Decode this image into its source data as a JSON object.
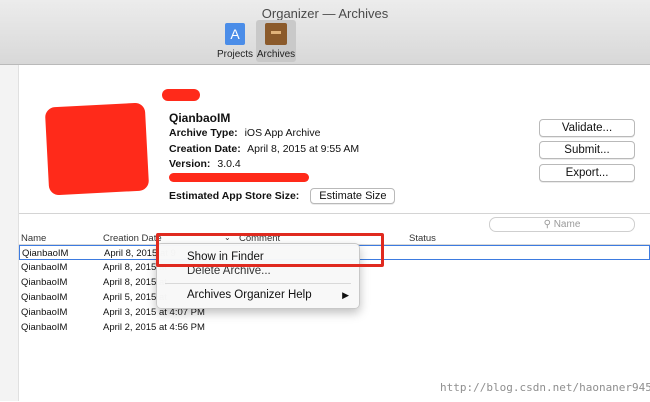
{
  "window": {
    "title": "Organizer — Archives"
  },
  "toolbar": {
    "tabs": [
      {
        "label": "Projects",
        "icon": "projects-icon"
      },
      {
        "label": "Archives",
        "icon": "archives-icon",
        "selected": true
      }
    ]
  },
  "archive": {
    "name": "QianbaoIM",
    "type_label": "Archive Type:",
    "type_value": "iOS App Archive",
    "date_label": "Creation Date:",
    "date_value": "April 8, 2015 at 9:55 AM",
    "version_label": "Version:",
    "version_value": "3.0.4",
    "size_label": "Estimated App Store Size:",
    "size_button": "Estimate Size"
  },
  "actions": {
    "validate": "Validate...",
    "submit": "Submit...",
    "export": "Export..."
  },
  "search": {
    "placeholder": "Name"
  },
  "table": {
    "columns": [
      "Name",
      "Creation Date",
      "Comment",
      "Status"
    ],
    "rows": [
      {
        "name": "QianbaoIM",
        "date": "April 8, 2015 at 9",
        "selected": true
      },
      {
        "name": "QianbaoIM",
        "date": "April 8, 2015 at"
      },
      {
        "name": "QianbaoIM",
        "date": "April 8, 2015 at"
      },
      {
        "name": "QianbaoIM",
        "date": "April 5, 2015 at"
      },
      {
        "name": "QianbaoIM",
        "date": "April 3, 2015 at 4:07 PM"
      },
      {
        "name": "QianbaoIM",
        "date": "April 2, 2015 at 4:56 PM"
      }
    ]
  },
  "context_menu": {
    "items": [
      "Show in Finder",
      "Delete Archive...",
      "Archives Organizer Help"
    ]
  },
  "watermark": "http://blog.csdn.net/haonaner9455",
  "colors": {
    "annotation_red": "#e02a1f",
    "selection_blue": "#3d7be0"
  }
}
